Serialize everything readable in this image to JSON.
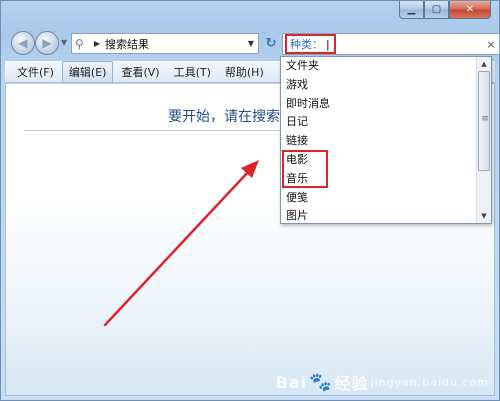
{
  "address_bar": {
    "path": "搜索结果"
  },
  "search": {
    "filter_label": "种类：",
    "value": "",
    "clear_glyph": "×"
  },
  "menu": {
    "items": [
      "文件(F)",
      "编辑(E)",
      "查看(V)",
      "工具(T)",
      "帮助(H)"
    ],
    "active_index": 1
  },
  "content": {
    "prompt": "要开始，请在搜索"
  },
  "dropdown": {
    "items": [
      "文件夹",
      "游戏",
      "即时消息",
      "日记",
      "链接",
      "电影",
      "音乐",
      "便笺",
      "图片"
    ],
    "highlighted": [
      "电影",
      "音乐"
    ]
  },
  "watermark": {
    "brand_left": "Bai",
    "brand_right": "经验",
    "sub": "jingyan.baidu.com"
  },
  "colors": {
    "highlight": "#e0222a",
    "link_blue": "#1f4e8f"
  }
}
